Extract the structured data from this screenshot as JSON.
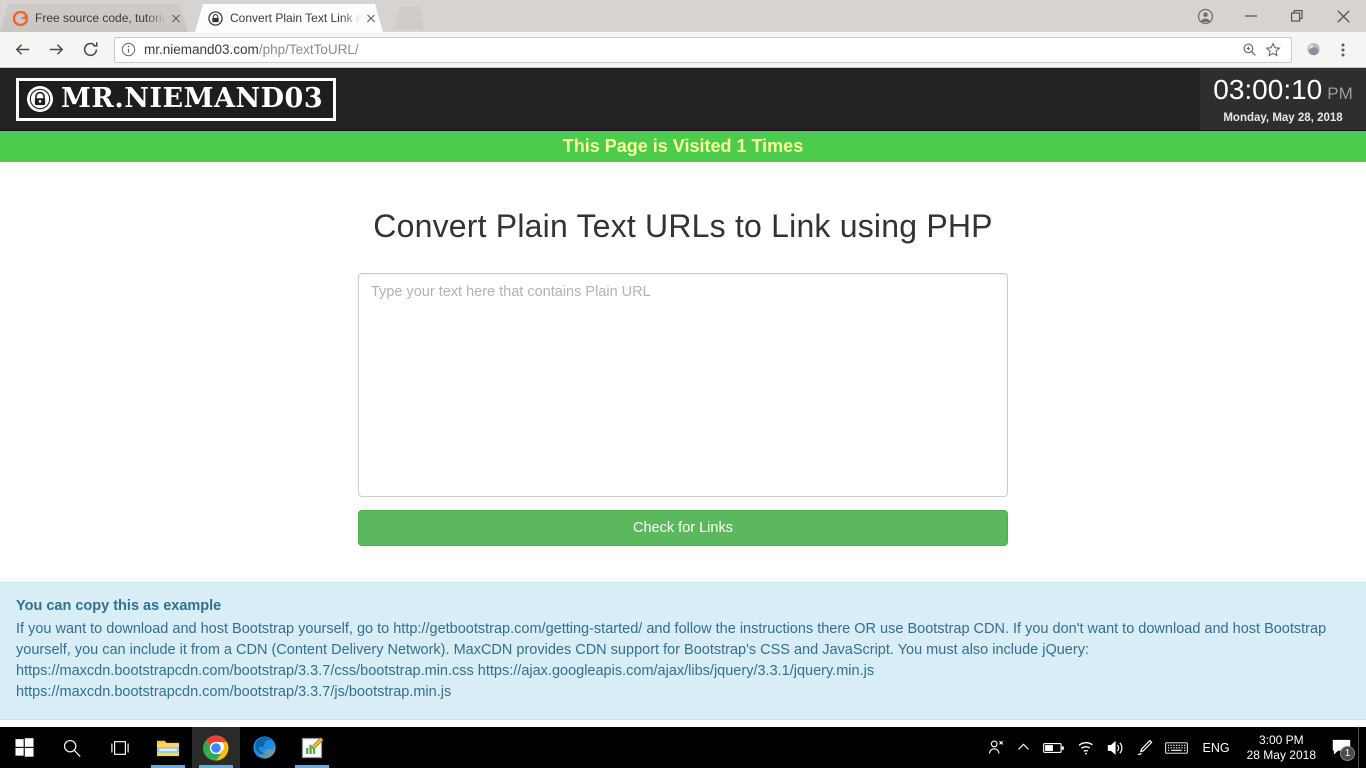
{
  "browser": {
    "tabs": [
      {
        "title": "Free source code, tutorial",
        "favicon": "orange-circle-icon",
        "active": false
      },
      {
        "title": "Convert Plain Text Link in",
        "favicon": "padlock-icon",
        "active": true
      }
    ],
    "window_controls": {
      "profile": "profile-avatar-icon",
      "minimize": "minimize-icon",
      "restore": "restore-icon",
      "close": "close-icon"
    },
    "toolbar": {
      "back": "back-arrow-icon",
      "forward": "forward-arrow-icon",
      "reload": "reload-icon",
      "page_info": "info-circle-icon",
      "url_domain": "mr.niemand03.com",
      "url_path": "/php/TextToURL/",
      "zoom_icon": "zoom-magnifier-icon",
      "bookmark_icon": "star-icon",
      "profile_icon": "account-icon",
      "menu_icon": "three-dot-menu-icon"
    }
  },
  "site": {
    "logo_text": "MR.NIEMAND03",
    "logo_badge_icon": "padlock-badge-icon",
    "clock": {
      "time": "03:00:10",
      "ampm": "PM",
      "date": "Monday, May 28, 2018"
    },
    "visit_banner": "This Page is Visited 1 Times",
    "page_title": "Convert Plain Text URLs to Link using PHP",
    "form": {
      "textarea_placeholder": "Type your text here that contains Plain URL",
      "textarea_value": "",
      "submit_label": "Check for Links"
    },
    "alert": {
      "title": "You can copy this as example",
      "line1": "If you want to download and host Bootstrap yourself, go to http://getbootstrap.com/getting-started/ and follow the instructions there OR use Bootstrap CDN. If you don't want to download and host Bootstrap yourself, you can include it from a CDN (Content Delivery Network). MaxCDN provides CDN support for Bootstrap's CSS and JavaScript. You must also include jQuery:",
      "line2": "https://maxcdn.bootstrapcdn.com/bootstrap/3.3.7/css/bootstrap.min.css https://ajax.googleapis.com/ajax/libs/jquery/3.3.1/jquery.min.js",
      "line3": "https://maxcdn.bootstrapcdn.com/bootstrap/3.3.7/js/bootstrap.min.js"
    },
    "colors": {
      "header_bg": "#222222",
      "banner_green": "#4ccc4c",
      "banner_text": "#fdfd9a",
      "button_green": "#5cb85c",
      "alert_bg": "#d9edf7",
      "alert_text": "#31708f"
    }
  },
  "taskbar": {
    "start": "windows-start-icon",
    "search": "search-icon",
    "taskview": "task-view-icon",
    "apps": [
      {
        "name": "file-explorer-icon"
      },
      {
        "name": "chrome-icon"
      },
      {
        "name": "firefox-icon"
      },
      {
        "name": "notepad-plus-icon"
      }
    ],
    "tray": {
      "people": "people-icon",
      "chevron": "chevron-up-icon",
      "battery": "battery-icon",
      "wifi": "wifi-icon",
      "volume": "volume-icon",
      "pen": "pen-ink-icon",
      "keyboard": "keyboard-icon",
      "language": "ENG",
      "time": "3:00 PM",
      "date": "28 May 2018",
      "notification_icon": "notification-icon",
      "notification_count": "1"
    }
  }
}
